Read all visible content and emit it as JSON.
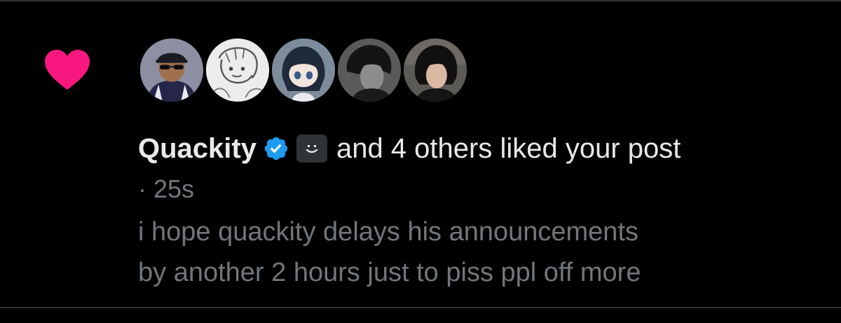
{
  "notification": {
    "type_icon": "heart-icon",
    "type_color": "#f91880",
    "avatars": [
      {
        "name": "avatar-1",
        "bg": "#8a8ea0"
      },
      {
        "name": "avatar-2",
        "bg": "#e6e6e6"
      },
      {
        "name": "avatar-3",
        "bg": "#6c7c8c"
      },
      {
        "name": "avatar-4",
        "bg": "#4a4a4a"
      },
      {
        "name": "avatar-5",
        "bg": "#3a3a3a"
      }
    ],
    "liker_name": "Quackity",
    "verified_icon": "verified-badge-icon",
    "verified_color": "#1d9bf0",
    "affiliate_icon": "smiley-badge-icon",
    "liker_rest": "and 4 others liked your post",
    "timestamp": "· 25s",
    "post_lines": [
      "i hope quackity delays his announcements",
      "by another 2 hours just to piss ppl off more"
    ]
  }
}
